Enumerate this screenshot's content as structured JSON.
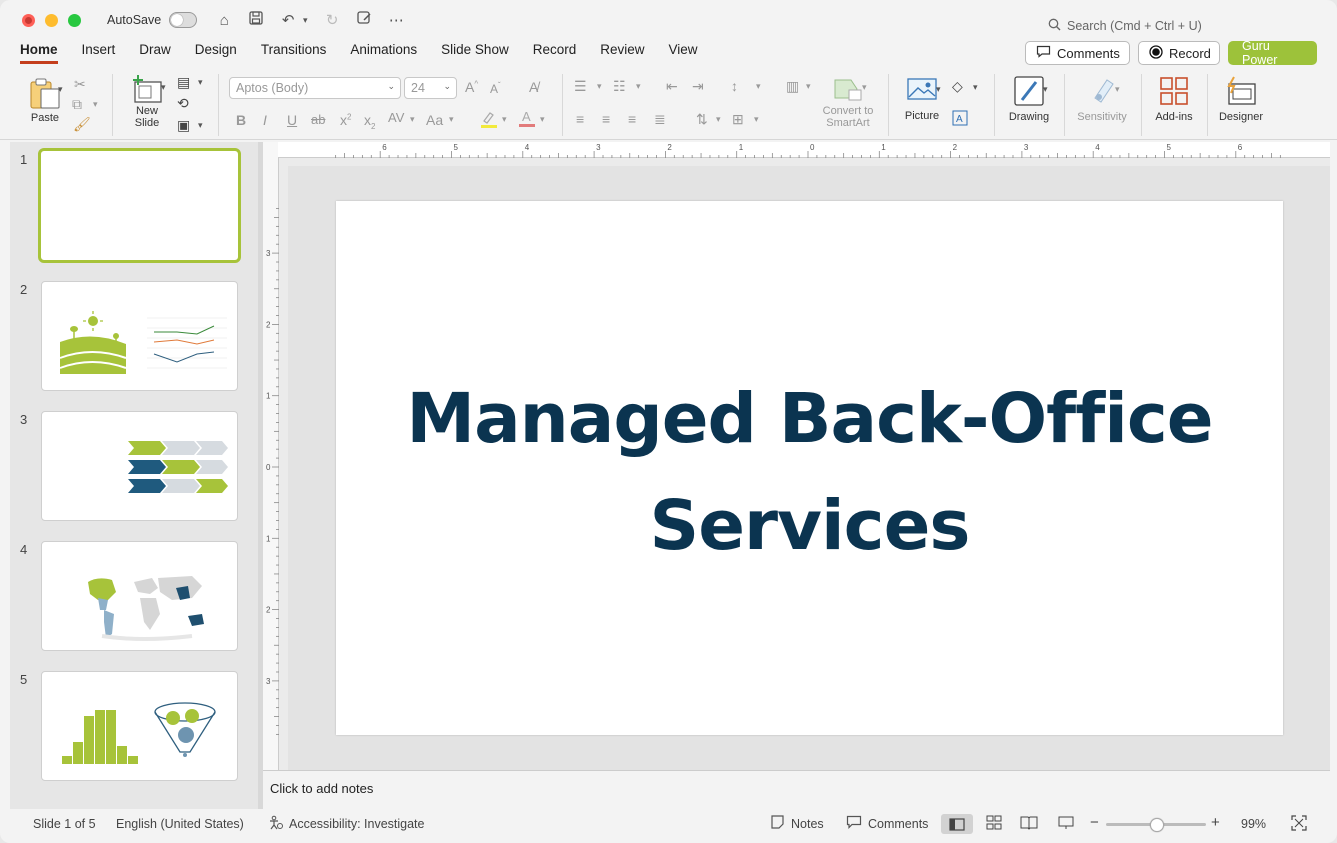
{
  "titlebar": {
    "autosave_label": "AutoSave",
    "search_placeholder": "Search (Cmd + Ctrl + U)"
  },
  "tabs": [
    "Home",
    "Insert",
    "Draw",
    "Design",
    "Transitions",
    "Animations",
    "Slide Show",
    "Record",
    "Review",
    "View"
  ],
  "active_tab": "Home",
  "header_buttons": {
    "comments": "Comments",
    "record": "Record",
    "guru": "Guru Power"
  },
  "ribbon": {
    "paste": "Paste",
    "new_slide_1": "New",
    "new_slide_2": "Slide",
    "font_name": "Aptos (Body)",
    "font_size": "24",
    "convert_1": "Convert to",
    "convert_2": "SmartArt",
    "picture": "Picture",
    "drawing": "Drawing",
    "sensitivity": "Sensitivity",
    "addins": "Add-ins",
    "designer": "Designer"
  },
  "slides": [
    {
      "num": "1"
    },
    {
      "num": "2"
    },
    {
      "num": "3"
    },
    {
      "num": "4"
    },
    {
      "num": "5"
    }
  ],
  "slide": {
    "title_line1": "Managed Back-Office",
    "title_line2": "Services"
  },
  "notes_placeholder": "Click to add notes",
  "status": {
    "slide_of": "Slide 1 of 5",
    "language": "English (United States)",
    "accessibility": "Accessibility: Investigate",
    "notes": "Notes",
    "comments": "Comments",
    "zoom": "99%"
  },
  "colors": {
    "accent_green": "#9dc23a",
    "title_navy": "#0b3450",
    "tab_underline": "#c43e1c"
  }
}
